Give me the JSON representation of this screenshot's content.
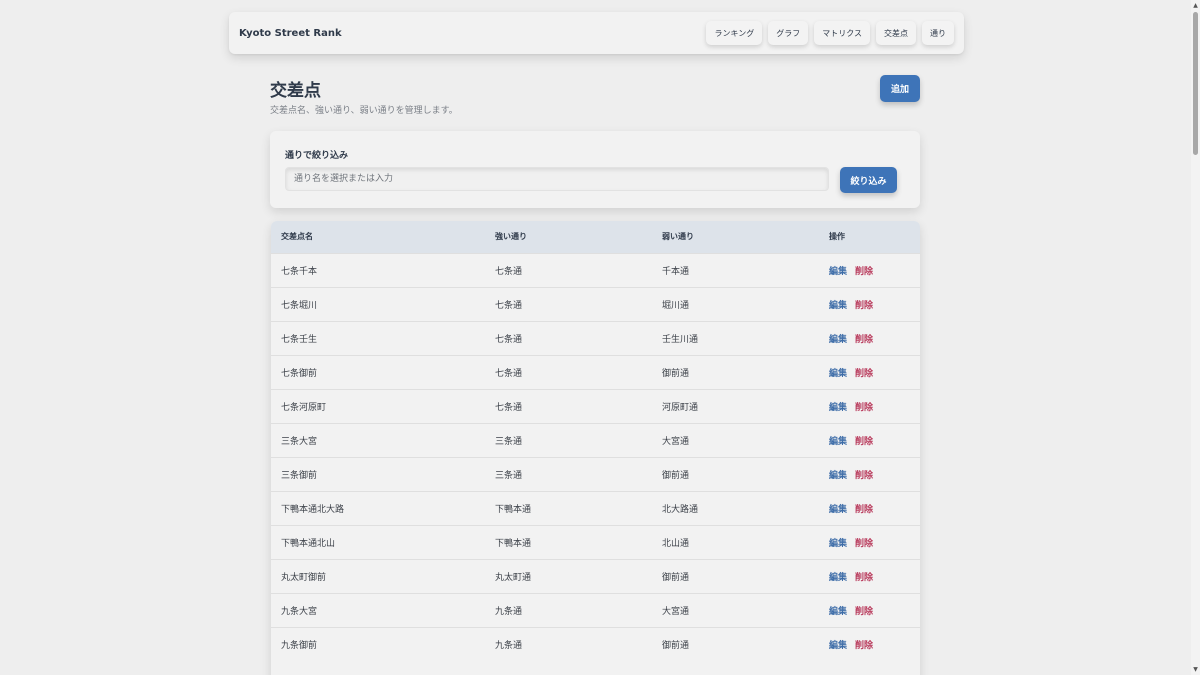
{
  "nav": {
    "brand": "Kyoto Street Rank",
    "links": [
      {
        "label": "ランキング"
      },
      {
        "label": "グラフ"
      },
      {
        "label": "マトリクス"
      },
      {
        "label": "交差点"
      },
      {
        "label": "通り"
      }
    ]
  },
  "header": {
    "title": "交差点",
    "subtitle": "交差点名、強い通り、弱い通りを管理します。",
    "add_label": "追加"
  },
  "filter": {
    "label": "通りで絞り込み",
    "placeholder": "通り名を選択または入力",
    "value": "",
    "button_label": "絞り込み"
  },
  "table": {
    "columns": [
      "交差点名",
      "強い通り",
      "弱い通り",
      "操作"
    ],
    "edit_label": "編集",
    "delete_label": "削除",
    "rows": [
      {
        "name": "七条千本",
        "strong": "七条通",
        "weak": "千本通"
      },
      {
        "name": "七条堀川",
        "strong": "七条通",
        "weak": "堀川通"
      },
      {
        "name": "七条壬生",
        "strong": "七条通",
        "weak": "壬生川通"
      },
      {
        "name": "七条御前",
        "strong": "七条通",
        "weak": "御前通"
      },
      {
        "name": "七条河原町",
        "strong": "七条通",
        "weak": "河原町通"
      },
      {
        "name": "三条大宮",
        "strong": "三条通",
        "weak": "大宮通"
      },
      {
        "name": "三条御前",
        "strong": "三条通",
        "weak": "御前通"
      },
      {
        "name": "下鴨本通北大路",
        "strong": "下鴨本通",
        "weak": "北大路通"
      },
      {
        "name": "下鴨本通北山",
        "strong": "下鴨本通",
        "weak": "北山通"
      },
      {
        "name": "丸太町御前",
        "strong": "丸太町通",
        "weak": "御前通"
      },
      {
        "name": "九条大宮",
        "strong": "九条通",
        "weak": "大宮通"
      },
      {
        "name": "九条御前",
        "strong": "九条通",
        "weak": "御前通"
      }
    ]
  },
  "scrollbar": {
    "up_icon": "▲",
    "down_icon": "▼"
  }
}
